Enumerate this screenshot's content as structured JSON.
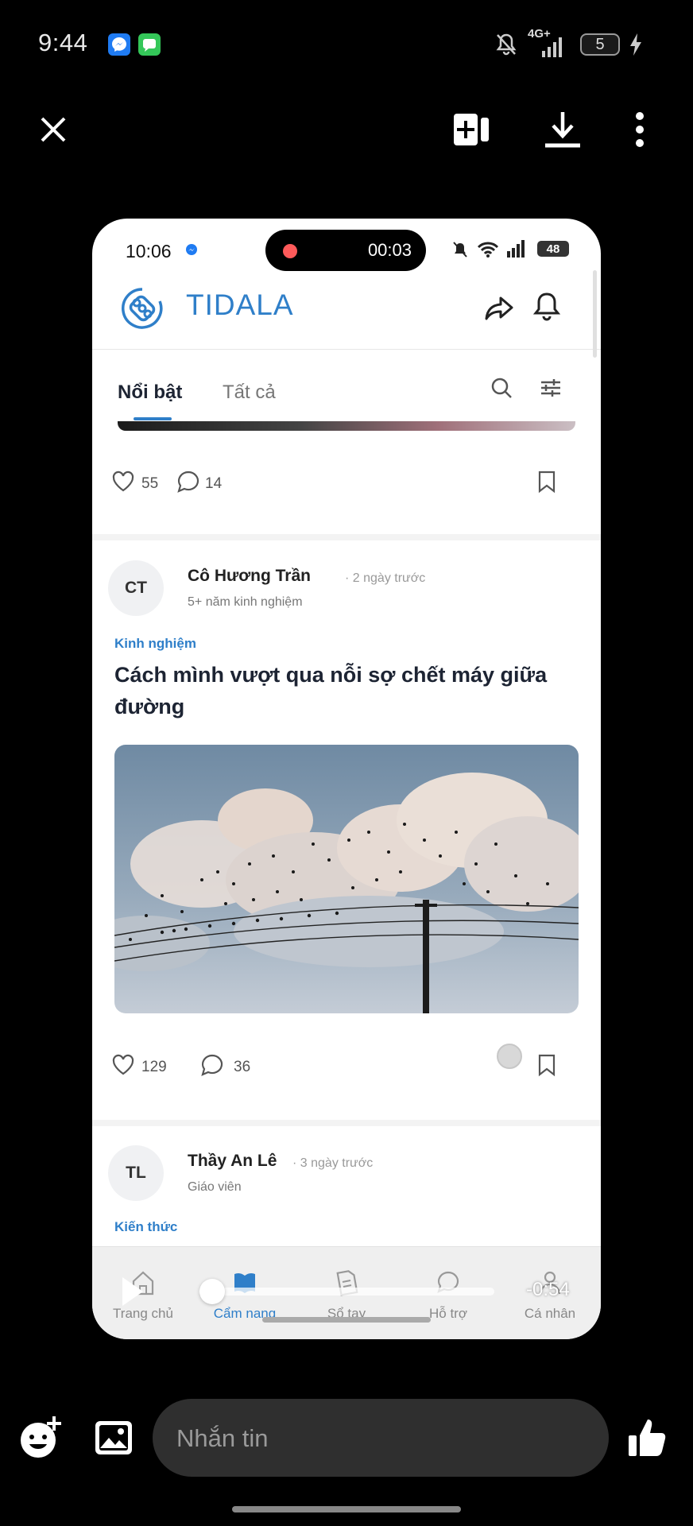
{
  "status_bar": {
    "time": "9:44",
    "network": "4G+",
    "battery": "5"
  },
  "viewer": {
    "close_icon": "close-icon",
    "add_icon": "add-to-collection-icon",
    "download_icon": "download-icon",
    "more_icon": "more-vertical-icon"
  },
  "phone": {
    "status": {
      "time": "10:06",
      "recording_time": "00:03",
      "battery": "48"
    },
    "app": {
      "brand": "TIDALA"
    },
    "tabs": [
      {
        "label": "Nổi bật",
        "active": true
      },
      {
        "label": "Tất cả",
        "active": false
      }
    ],
    "previous_post": {
      "likes": "55",
      "comments": "14"
    },
    "post": {
      "avatar": "CT",
      "author": "Cô Hương Trần",
      "time": "· 2 ngày trước",
      "subtitle": "5+ năm kinh nghiệm",
      "category": "Kinh nghiệm",
      "title": "Cách mình vượt qua nỗi sợ chết máy giữa đường",
      "likes": "129",
      "comments": "36"
    },
    "next_post": {
      "avatar": "TL",
      "author": "Thầy An Lê",
      "time": "· 3 ngày trước",
      "subtitle": "Giáo viên",
      "category": "Kiến thức"
    },
    "bottom_nav": [
      {
        "label": "Trang chủ",
        "icon": "home-icon",
        "active": false
      },
      {
        "label": "Cẩm nang",
        "icon": "book-icon",
        "active": true
      },
      {
        "label": "Sổ tay",
        "icon": "notebook-icon",
        "active": false
      },
      {
        "label": "Hỗ trợ",
        "icon": "chat-bubble-icon",
        "active": false
      },
      {
        "label": "Cá nhân",
        "icon": "person-icon",
        "active": false
      }
    ]
  },
  "video": {
    "remaining": "-0:54",
    "progress": 0.02
  },
  "composer": {
    "placeholder": "Nhắn tin"
  },
  "colors": {
    "accent": "#2f7fc9",
    "background": "#000000"
  }
}
